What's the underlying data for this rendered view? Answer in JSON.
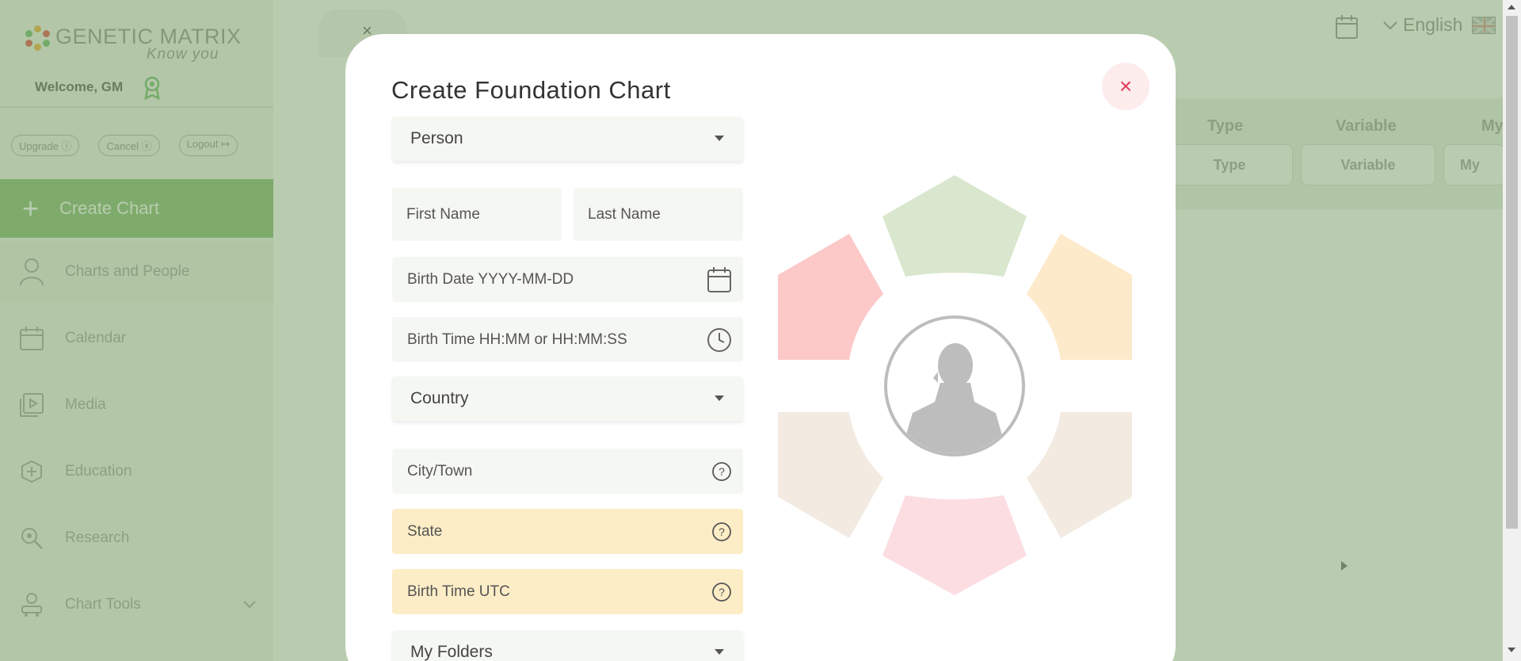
{
  "app": {
    "logo_text": "GENETIC MATRIX",
    "logo_tagline": "Know you",
    "welcome": "Welcome, GM",
    "pills": [
      "Upgrade ⓘ",
      "Cancel ⓧ",
      "Logout ↦"
    ],
    "create_chart": "Create Chart",
    "nav": [
      {
        "label": "Charts and People",
        "icon": "person-icon"
      },
      {
        "label": "Calendar",
        "icon": "calendar-icon"
      },
      {
        "label": "Media",
        "icon": "media-icon"
      },
      {
        "label": "Education",
        "icon": "education-icon"
      },
      {
        "label": "Research",
        "icon": "research-icon"
      },
      {
        "label": "Chart Tools",
        "icon": "chart-tools-icon"
      }
    ],
    "language": "English",
    "background_tab_close": "×",
    "table_headers": [
      "Type",
      "Variable",
      "My"
    ],
    "table_filters": [
      "Type",
      "Variable",
      "My"
    ]
  },
  "modal": {
    "title": "Create Foundation Chart",
    "close": "×",
    "chart_type": "Person",
    "first_name_placeholder": "First Name",
    "last_name_placeholder": "Last Name",
    "birth_date_placeholder": "Birth Date YYYY-MM-DD",
    "birth_time_placeholder": "Birth Time HH:MM or HH:MM:SS",
    "country": "Country",
    "city_placeholder": "City/Town",
    "state_placeholder": "State",
    "utc_placeholder": "Birth Time UTC",
    "folders": "My Folders"
  },
  "colors": {
    "overlay": "#6c9458",
    "accent_green": "#8fc07f",
    "close_red": "#e23b5c",
    "warn_field": "#fdedc6",
    "hex_top": "#d8e7cd",
    "hex_upper_left": "#fcc8c8",
    "hex_upper_right": "#fdeacb",
    "hex_lower_left": "#f3ebe2",
    "hex_lower_right": "#f3ebe2",
    "hex_bottom": "#fcdde2"
  }
}
